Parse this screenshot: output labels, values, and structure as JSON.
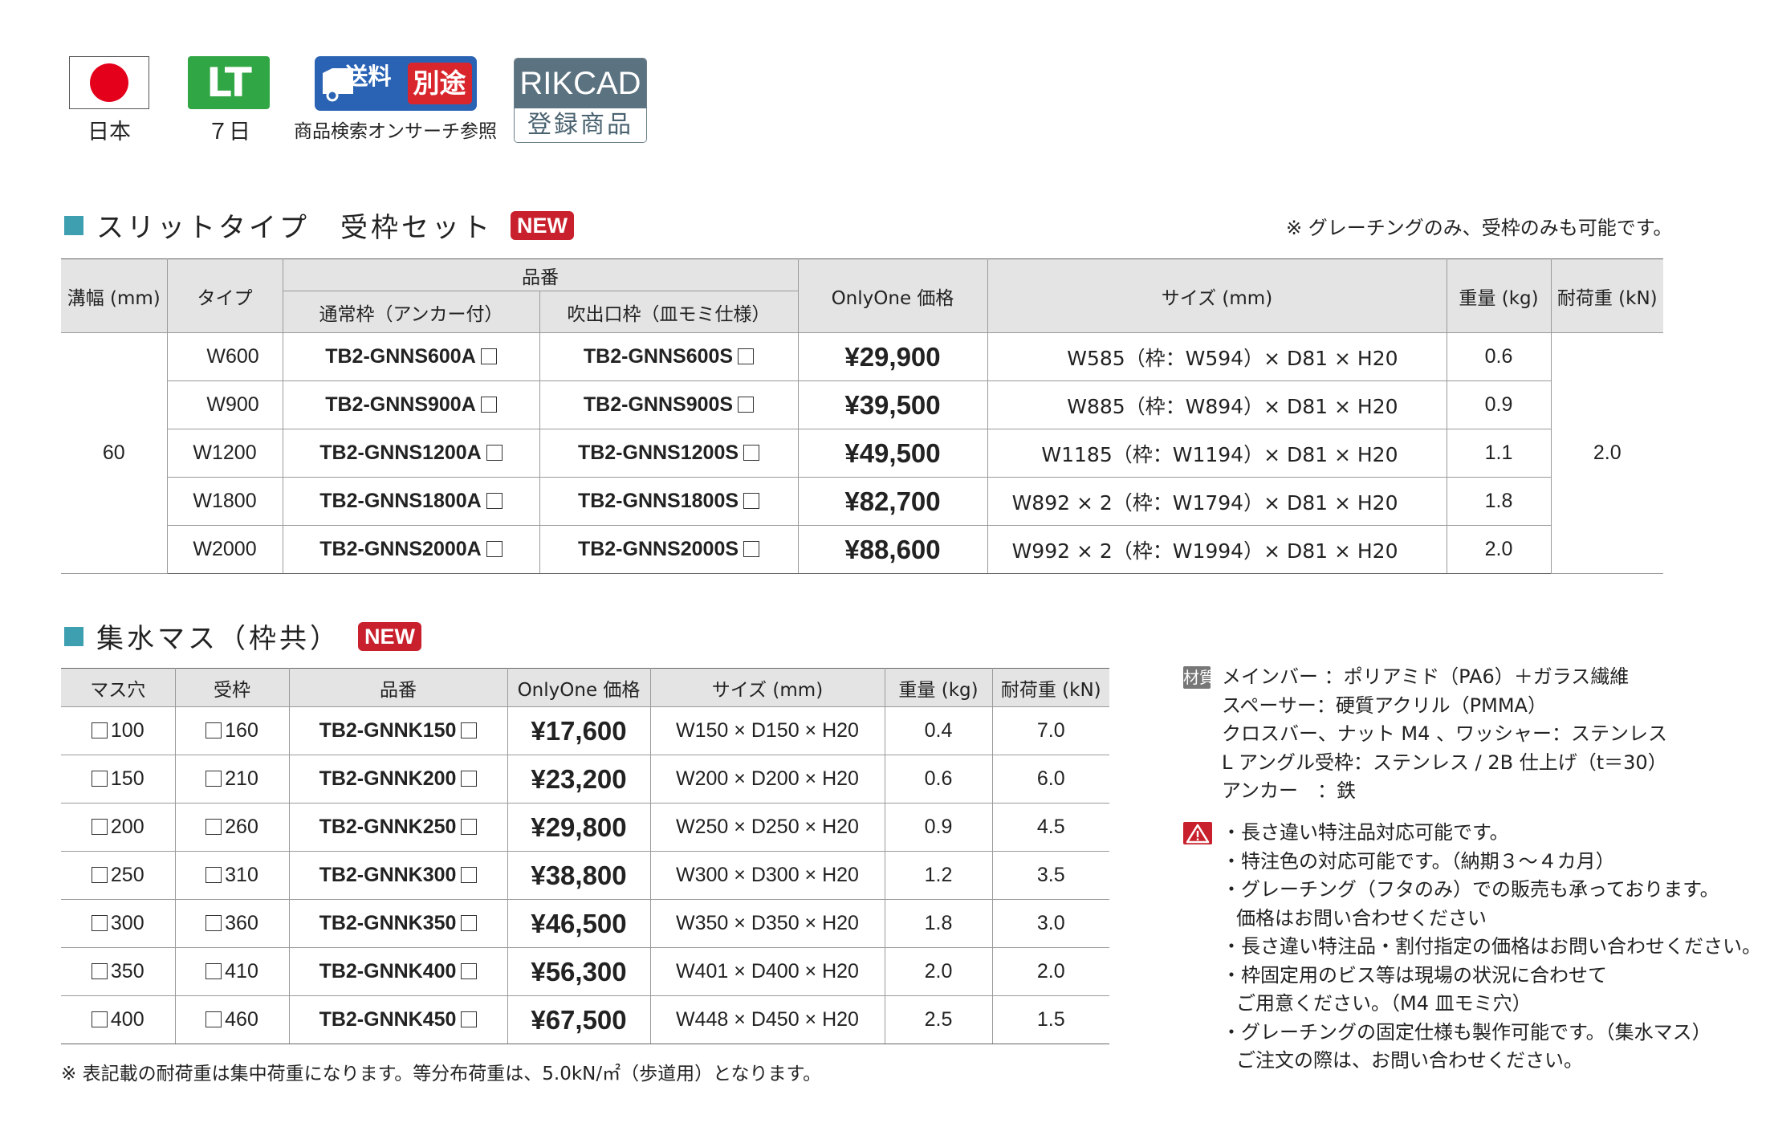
{
  "badges": {
    "origin_label": "日本",
    "lt_text": "LT",
    "lt_label": "７日",
    "ship_text1": "送料",
    "ship_text2": "別途",
    "ship_label": "商品検索オンサーチ参照",
    "rikcad_top": "RIKCAD",
    "rikcad_bottom": "登録商品",
    "colors": {
      "flag_red": "#e4001b",
      "lt_green": "#31a644",
      "ship_blue": "#2a63b4",
      "ship_red": "#d8262c",
      "rikcad_gray": "#5b7280"
    }
  },
  "section1": {
    "title": "スリットタイプ　受枠セット",
    "new_badge": "NEW",
    "note": "※ グレーチングのみ、受枠のみも可能です。",
    "headers": {
      "width": "溝幅 (mm)",
      "type": "タイプ",
      "part_no": "品番",
      "normal_frame": "通常枠（アンカー付）",
      "outlet_frame": "吹出口枠（皿モミ仕様）",
      "price": "OnlyOne 価格",
      "size": "サイズ (mm)",
      "weight": "重量 (kg)",
      "load": "耐荷重 (kN)"
    },
    "width_value": "60",
    "load_value": "2.0",
    "rows": [
      {
        "type": "W600",
        "normal": "TB2-GNNS600A",
        "outlet": "TB2-GNNS600S",
        "price": "¥29,900",
        "size": "W585（枠：W594）× D81 × H20",
        "weight": "0.6"
      },
      {
        "type": "W900",
        "normal": "TB2-GNNS900A",
        "outlet": "TB2-GNNS900S",
        "price": "¥39,500",
        "size": "W885（枠：W894）× D81 × H20",
        "weight": "0.9"
      },
      {
        "type": "W1200",
        "normal": "TB2-GNNS1200A",
        "outlet": "TB2-GNNS1200S",
        "price": "¥49,500",
        "size": "W1185（枠：W1194）× D81 × H20",
        "weight": "1.1"
      },
      {
        "type": "W1800",
        "normal": "TB2-GNNS1800A",
        "outlet": "TB2-GNNS1800S",
        "price": "¥82,700",
        "size": "W892 × 2（枠：W1794）× D81 × H20",
        "weight": "1.8"
      },
      {
        "type": "W2000",
        "normal": "TB2-GNNS2000A",
        "outlet": "TB2-GNNS2000S",
        "price": "¥88,600",
        "size": "W992 × 2（枠：W1994）× D81 × H20",
        "weight": "2.0"
      }
    ]
  },
  "section2": {
    "title": "集水マス（枠共）",
    "new_badge": "NEW",
    "headers": {
      "hole": "マス穴",
      "frame": "受枠",
      "part_no": "品番",
      "price": "OnlyOne 価格",
      "size": "サイズ (mm)",
      "weight": "重量 (kg)",
      "load": "耐荷重 (kN)"
    },
    "rows": [
      {
        "hole": "100",
        "frame": "160",
        "part": "TB2-GNNK150",
        "price": "¥17,600",
        "size": "W150 × D150 × H20",
        "weight": "0.4",
        "load": "7.0"
      },
      {
        "hole": "150",
        "frame": "210",
        "part": "TB2-GNNK200",
        "price": "¥23,200",
        "size": "W200 × D200 × H20",
        "weight": "0.6",
        "load": "6.0"
      },
      {
        "hole": "200",
        "frame": "260",
        "part": "TB2-GNNK250",
        "price": "¥29,800",
        "size": "W250 × D250 × H20",
        "weight": "0.9",
        "load": "4.5"
      },
      {
        "hole": "250",
        "frame": "310",
        "part": "TB2-GNNK300",
        "price": "¥38,800",
        "size": "W300 × D300 × H20",
        "weight": "1.2",
        "load": "3.5"
      },
      {
        "hole": "300",
        "frame": "360",
        "part": "TB2-GNNK350",
        "price": "¥46,500",
        "size": "W350 × D350 × H20",
        "weight": "1.8",
        "load": "3.0"
      },
      {
        "hole": "350",
        "frame": "410",
        "part": "TB2-GNNK400",
        "price": "¥56,300",
        "size": "W401 × D400 × H20",
        "weight": "2.0",
        "load": "2.0"
      },
      {
        "hole": "400",
        "frame": "460",
        "part": "TB2-GNNK450",
        "price": "¥67,500",
        "size": "W448 × D450 × H20",
        "weight": "2.5",
        "load": "1.5"
      }
    ],
    "footnote": "※ 表記載の耐荷重は集中荷重になります。等分布荷重は、5.0kN/㎡（歩道用）となります。"
  },
  "materials": {
    "tag": "材質",
    "lines": [
      "メインバー ：ポリアミド（PA6）＋ガラス繊維",
      "スペーサー：硬質アクリル（PMMA）",
      "クロスバー、ナット M4 、ワッシャー：ステンレス",
      "L アングル受枠：ステンレス / 2B 仕上げ（t＝30）",
      "アンカー　：鉄"
    ]
  },
  "warnings": {
    "lines": [
      "・長さ違い特注品対応可能です。",
      "・特注色の対応可能です。（納期３～４カ月）",
      "・グレーチング（フタのみ）での販売も承っております。",
      "価格はお問い合わせください",
      "・長さ違い特注品・割付指定の価格はお問い合わせください。",
      "・枠固定用のビス等は現場の状況に合わせて",
      "ご用意ください。（M4 皿モミ穴）",
      "・グレーチングの固定仕様も製作可能です。（集水マス）",
      "ご注文の際は、お問い合わせください。"
    ]
  }
}
